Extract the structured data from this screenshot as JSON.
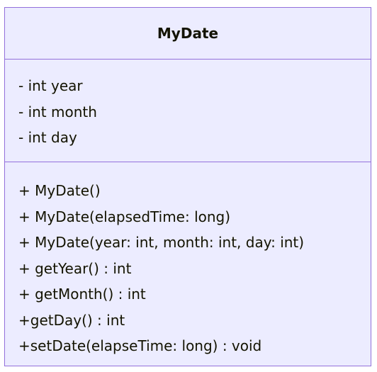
{
  "class": {
    "name": "MyDate",
    "attributes": [
      "- int year",
      "- int month",
      "- int day"
    ],
    "methods": [
      "+ MyDate()",
      "+ MyDate(elapsedTime: long)",
      "+ MyDate(year: int, month: int, day: int)",
      "+ getYear() : int",
      "+ getMonth() : int",
      "+getDay() : int",
      "+setDate(elapseTime: long) : void"
    ]
  },
  "colors": {
    "fill": "#ECECFF",
    "border": "#9370DB",
    "text": "#131300"
  }
}
